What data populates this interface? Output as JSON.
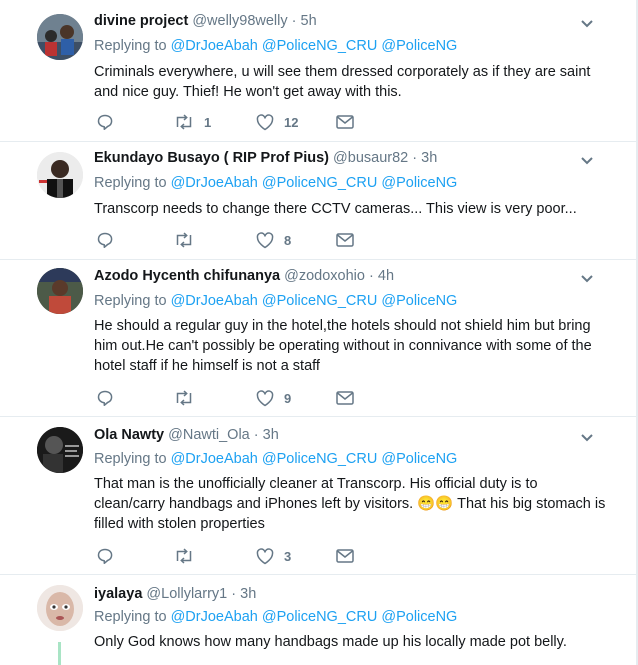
{
  "tweets": [
    {
      "name": "divine project",
      "handle": "@welly98welly",
      "dot": "·",
      "time": "5h",
      "replying_label": "Replying to",
      "mentions": [
        "@DrJoeAbah",
        "@PoliceNG_CRU",
        "@PoliceNG"
      ],
      "text": "Criminals everywhere, u will see them dressed corporately as if they are saint and nice guy. Thief! He won't get away with this.",
      "retweets": "1",
      "likes": "12"
    },
    {
      "name": "Ekundayo Busayo ( RIP Prof Pius)",
      "handle": "@busaur82",
      "dot": "·",
      "time": "3h",
      "replying_label": "Replying to",
      "mentions": [
        "@DrJoeAbah",
        "@PoliceNG_CRU",
        "@PoliceNG"
      ],
      "text": "Transcorp needs to change there CCTV cameras... This view is very poor...",
      "retweets": "",
      "likes": "8"
    },
    {
      "name": "Azodo Hycenth chifunanya",
      "handle": "@zodoxohio",
      "dot": "·",
      "time": "4h",
      "replying_label": "Replying to",
      "mentions": [
        "@DrJoeAbah",
        "@PoliceNG_CRU",
        "@PoliceNG"
      ],
      "text": "He should a regular guy in the hotel,the hotels should not shield him but bring him out.He can't possibly be operating without in connivance with some of the hotel staff if he himself is not a staff",
      "retweets": "",
      "likes": "9"
    },
    {
      "name": "Ola Nawty",
      "handle": "@Nawti_Ola",
      "dot": "·",
      "time": "3h",
      "replying_label": "Replying to",
      "mentions": [
        "@DrJoeAbah",
        "@PoliceNG_CRU",
        "@PoliceNG"
      ],
      "text": "That man is the unofficially cleaner at Transcorp. His official duty is to clean/carry handbags and iPhones left by visitors. 😁😁 That his big stomach is filled with stolen properties",
      "retweets": "",
      "likes": "3"
    },
    {
      "name": "iyalaya",
      "handle": "@Lollylarry1",
      "dot": "·",
      "time": "3h",
      "replying_label": "Replying to",
      "mentions": [
        "@DrJoeAbah",
        "@PoliceNG_CRU",
        "@PoliceNG"
      ],
      "text": "Only God knows how many handbags made up his locally made pot belly.",
      "retweets": "",
      "likes": ""
    }
  ],
  "colors": {
    "mention": "#1da1f2",
    "muted": "#657786",
    "thread_line": "#a9e4c5"
  },
  "icons": [
    "reply-icon",
    "retweet-icon",
    "like-icon",
    "dm-icon",
    "chevron-down-icon"
  ]
}
